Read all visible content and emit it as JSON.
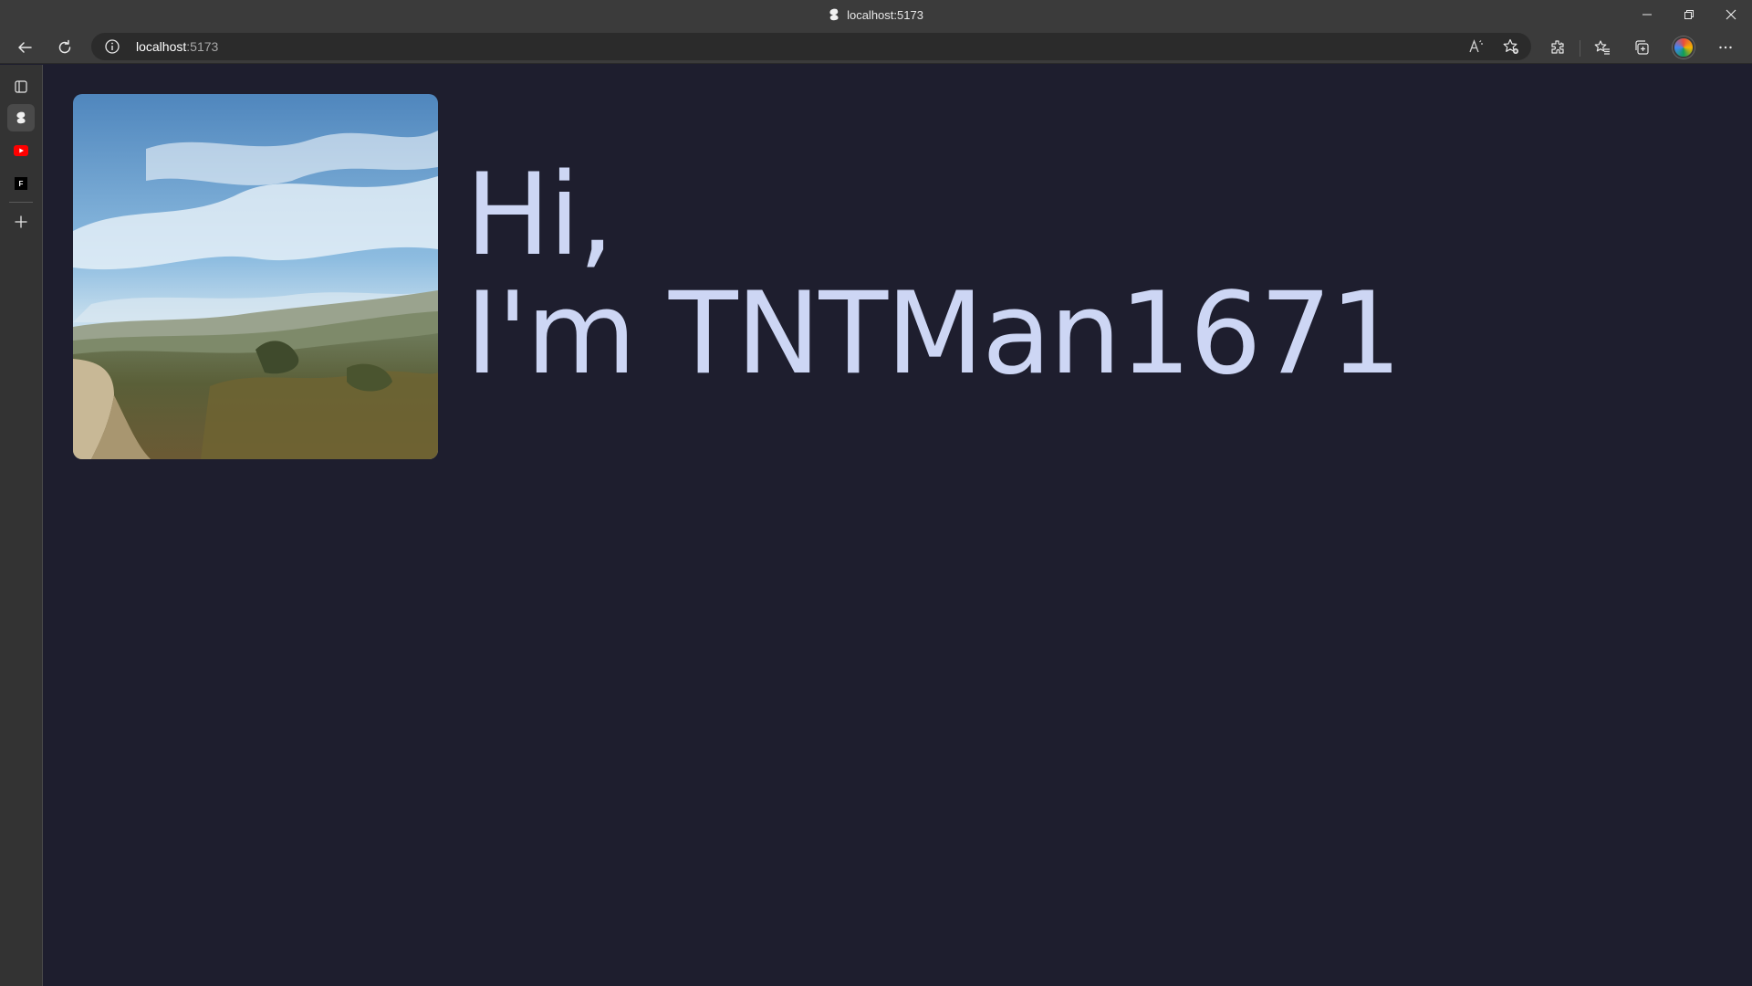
{
  "window": {
    "title": "localhost:5173",
    "controls": [
      "minimize-icon",
      "restore-icon",
      "close-icon"
    ]
  },
  "toolbar": {
    "back_icon": "back-arrow-icon",
    "refresh_icon": "refresh-icon",
    "url_host": "localhost",
    "url_port": ":5173",
    "right_icons": [
      "read-aloud-icon",
      "add-favorite-icon",
      "extensions-icon",
      "favorites-icon",
      "collections-icon",
      "profile-avatar",
      "more-menu-icon"
    ]
  },
  "sidebar": {
    "items": [
      {
        "name": "tab-actions-icon"
      },
      {
        "name": "tab-localhost",
        "active": true
      },
      {
        "name": "tab-youtube"
      },
      {
        "name": "tab-f-site"
      },
      {
        "name": "new-tab-icon"
      }
    ],
    "f_site_letter": "F"
  },
  "main": {
    "greeting_line1": "Hi,",
    "greeting_line2": "I'm TNTMan1671",
    "text_color": "#cdd6f4",
    "background": "#1e1e2e"
  },
  "colors": {
    "browser_chrome": "#3b3b3b",
    "omnibox": "#2b2b2b",
    "sidebar": "#333333",
    "youtube_red": "#ff0000"
  }
}
